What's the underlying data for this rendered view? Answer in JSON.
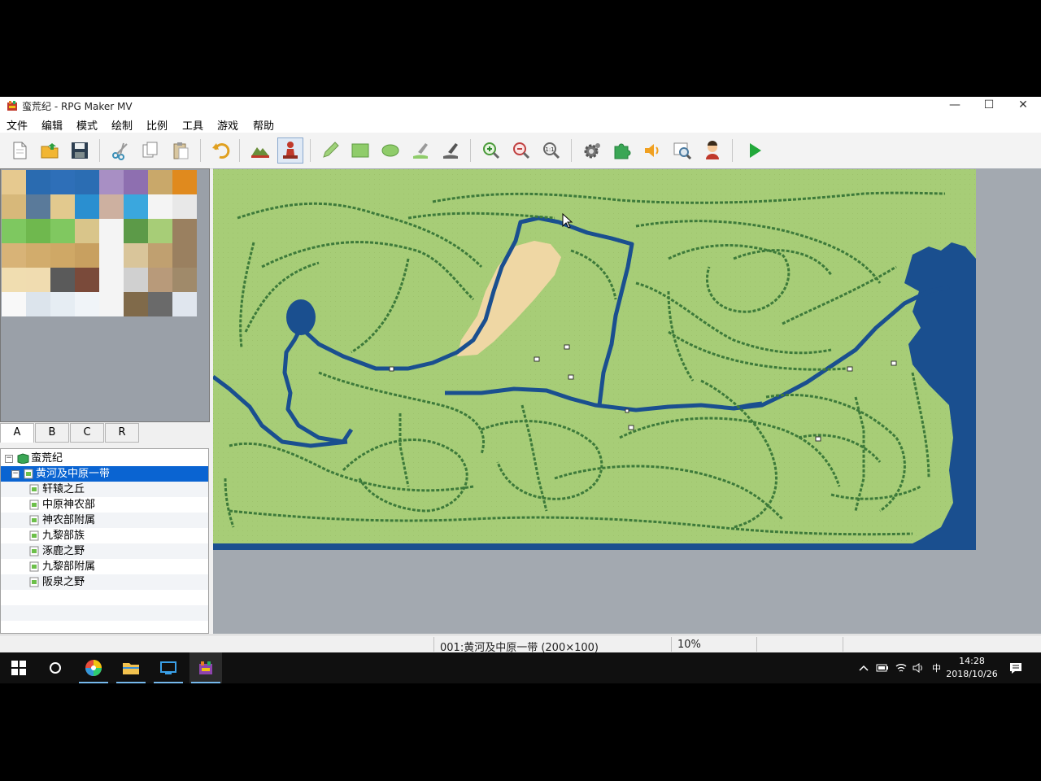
{
  "window": {
    "title": "蛮荒纪 - RPG Maker MV",
    "controls": {
      "minimize": "—",
      "maximize": "☐",
      "close": "✕"
    }
  },
  "menu": {
    "items": [
      "文件",
      "编辑",
      "模式",
      "绘制",
      "比例",
      "工具",
      "游戏",
      "帮助"
    ]
  },
  "toolbar": {
    "buttons": [
      "new-project",
      "open-project",
      "save-project",
      "cut",
      "copy",
      "paste",
      "undo",
      "map-mode",
      "event-mode",
      "pencil",
      "rectangle",
      "ellipse",
      "fill",
      "shadow-pen",
      "zoom-in",
      "zoom-out",
      "actual-size",
      "database",
      "plugin-manager",
      "sound-test",
      "event-searcher",
      "character-generator",
      "playtest"
    ],
    "active": "event-mode"
  },
  "tileset": {
    "tabs": [
      "A",
      "B",
      "C",
      "R"
    ],
    "active_tab": "A"
  },
  "map_tree": {
    "project": "蛮荒纪",
    "selected": "黄河及中原一带",
    "children": [
      "轩辕之丘",
      "中原神农部",
      "神农部附属",
      "九黎部族",
      "涿鹿之野",
      "九黎部附属",
      "阪泉之野"
    ]
  },
  "status": {
    "map": "001:黄河及中原一带 (200×100)",
    "zoom": "10%"
  },
  "taskbar": {
    "time": "14:28",
    "date": "2018/10/26",
    "ime": "中"
  },
  "colors": {
    "grass": "#a7cd77",
    "forest": "#3d7a3a",
    "water": "#1a4f8f",
    "sand": "#efd7a4",
    "selection": "#0a64d2",
    "map_bg": "#a3a9b0"
  }
}
